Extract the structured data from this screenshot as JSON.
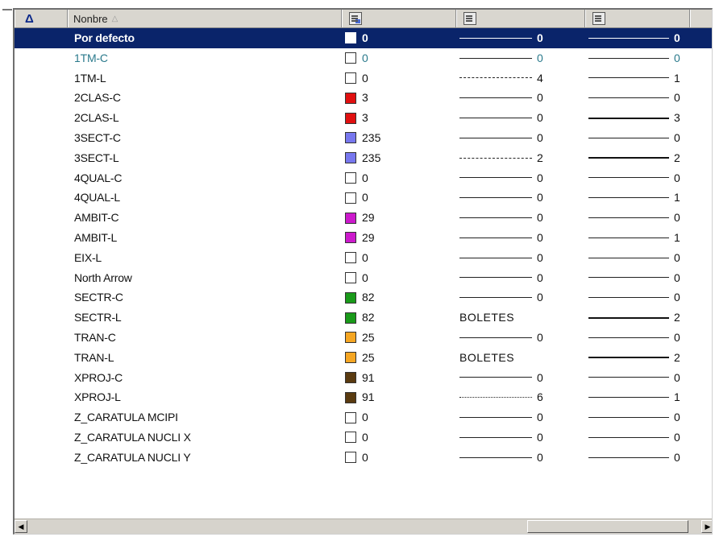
{
  "header": {
    "sort_indicator": "Δ",
    "name_label": "Nonbre",
    "name_sort_mark": "△",
    "columns_icons": [
      "color-column-icon",
      "linetype-column-icon",
      "lineweight-column-icon"
    ]
  },
  "rows": [
    {
      "name": "Por defecto",
      "swatch": "#ffffff",
      "color": "0",
      "lt_style": "solid",
      "lt_text": "",
      "lt_num": "0",
      "lw_style": "thin",
      "lw_num": "0",
      "selected": true
    },
    {
      "name": "1TM-C",
      "swatch": "#ffffff",
      "color": "0",
      "lt_style": "solid",
      "lt_text": "",
      "lt_num": "0",
      "lw_style": "thin",
      "lw_num": "0",
      "accent": "#2b7a8c"
    },
    {
      "name": "1TM-L",
      "swatch": "#ffffff",
      "color": "0",
      "lt_style": "dashdot",
      "lt_text": "",
      "lt_num": "4",
      "lw_style": "thin",
      "lw_num": "1"
    },
    {
      "name": "2CLAS-C",
      "swatch": "#e01010",
      "color": "3",
      "lt_style": "solid",
      "lt_text": "",
      "lt_num": "0",
      "lw_style": "thin",
      "lw_num": "0"
    },
    {
      "name": "2CLAS-L",
      "swatch": "#e01010",
      "color": "3",
      "lt_style": "solid",
      "lt_text": "",
      "lt_num": "0",
      "lw_style": "thick",
      "lw_num": "3"
    },
    {
      "name": "3SECT-C",
      "swatch": "#7777ee",
      "color": "235",
      "lt_style": "solid",
      "lt_text": "",
      "lt_num": "0",
      "lw_style": "thin",
      "lw_num": "0"
    },
    {
      "name": "3SECT-L",
      "swatch": "#7777ee",
      "color": "235",
      "lt_style": "dashed",
      "lt_text": "",
      "lt_num": "2",
      "lw_style": "thick",
      "lw_num": "2"
    },
    {
      "name": "4QUAL-C",
      "swatch": "#ffffff",
      "color": "0",
      "lt_style": "solid",
      "lt_text": "",
      "lt_num": "0",
      "lw_style": "thin",
      "lw_num": "0"
    },
    {
      "name": "4QUAL-L",
      "swatch": "#ffffff",
      "color": "0",
      "lt_style": "solid",
      "lt_text": "",
      "lt_num": "0",
      "lw_style": "thin",
      "lw_num": "1"
    },
    {
      "name": "AMBIT-C",
      "swatch": "#cc1acc",
      "color": "29",
      "lt_style": "solid",
      "lt_text": "",
      "lt_num": "0",
      "lw_style": "thin",
      "lw_num": "0"
    },
    {
      "name": "AMBIT-L",
      "swatch": "#cc1acc",
      "color": "29",
      "lt_style": "solid",
      "lt_text": "",
      "lt_num": "0",
      "lw_style": "thin",
      "lw_num": "1"
    },
    {
      "name": "EIX-L",
      "swatch": "#ffffff",
      "color": "0",
      "lt_style": "solid",
      "lt_text": "",
      "lt_num": "0",
      "lw_style": "thin",
      "lw_num": "0"
    },
    {
      "name": "North Arrow",
      "swatch": "#ffffff",
      "color": "0",
      "lt_style": "solid",
      "lt_text": "",
      "lt_num": "0",
      "lw_style": "thin",
      "lw_num": "0"
    },
    {
      "name": "SECTR-C",
      "swatch": "#1a9a1a",
      "color": "82",
      "lt_style": "solid",
      "lt_text": "",
      "lt_num": "0",
      "lw_style": "thin",
      "lw_num": "0"
    },
    {
      "name": "SECTR-L",
      "swatch": "#1a9a1a",
      "color": "82",
      "lt_style": "text",
      "lt_text": "BOLETES",
      "lt_num": "",
      "lw_style": "thick",
      "lw_num": "2"
    },
    {
      "name": "TRAN-C",
      "swatch": "#f5a623",
      "color": "25",
      "lt_style": "solid",
      "lt_text": "",
      "lt_num": "0",
      "lw_style": "thin",
      "lw_num": "0"
    },
    {
      "name": "TRAN-L",
      "swatch": "#f5a623",
      "color": "25",
      "lt_style": "text",
      "lt_text": "BOLETES",
      "lt_num": "",
      "lw_style": "thick",
      "lw_num": "2"
    },
    {
      "name": "XPROJ-C",
      "swatch": "#5a3b10",
      "color": "91",
      "lt_style": "solid",
      "lt_text": "",
      "lt_num": "0",
      "lw_style": "thin",
      "lw_num": "0"
    },
    {
      "name": "XPROJ-L",
      "swatch": "#5a3b10",
      "color": "91",
      "lt_style": "dotted",
      "lt_text": "",
      "lt_num": "6",
      "lw_style": "thin",
      "lw_num": "1"
    },
    {
      "name": "Z_CARATULA MCIPI",
      "swatch": "#ffffff",
      "color": "0",
      "lt_style": "solid",
      "lt_text": "",
      "lt_num": "0",
      "lw_style": "thin",
      "lw_num": "0"
    },
    {
      "name": "Z_CARATULA NUCLI X",
      "swatch": "#ffffff",
      "color": "0",
      "lt_style": "solid",
      "lt_text": "",
      "lt_num": "0",
      "lw_style": "thin",
      "lw_num": "0"
    },
    {
      "name": "Z_CARATULA NUCLI Y",
      "swatch": "#ffffff",
      "color": "0",
      "lt_style": "solid",
      "lt_text": "",
      "lt_num": "0",
      "lw_style": "thin",
      "lw_num": "0"
    }
  ],
  "scrollbar": {
    "left_arrow": "◀",
    "right_arrow": "▶"
  }
}
